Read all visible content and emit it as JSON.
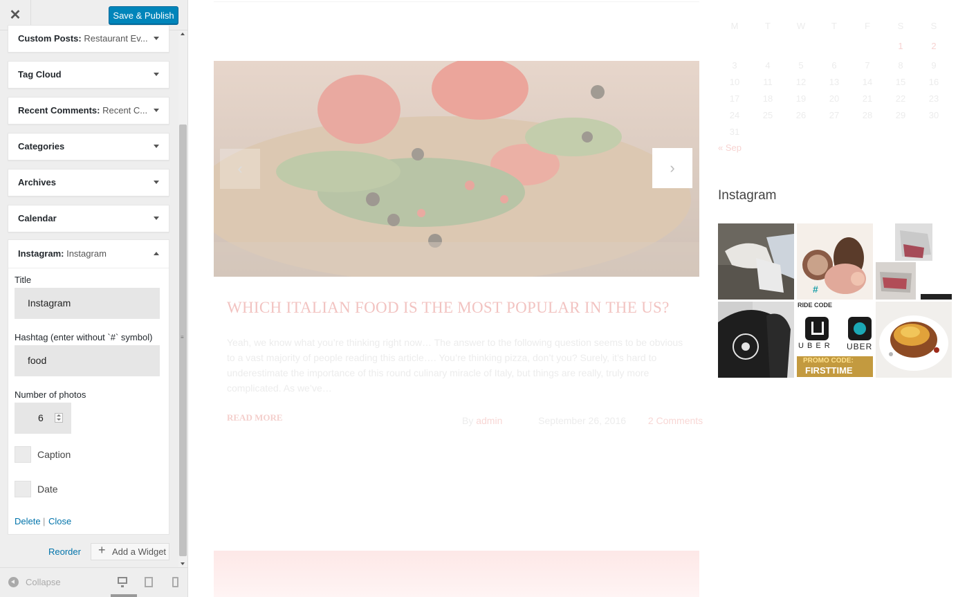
{
  "header": {
    "close_icon": "close-icon",
    "save_label": "Save & Publish"
  },
  "widgets": [
    {
      "title": "Custom Posts:",
      "sub": "Restaurant Ev..."
    },
    {
      "title": "Tag Cloud",
      "sub": ""
    },
    {
      "title": "Recent Comments:",
      "sub": "Recent C..."
    },
    {
      "title": "Categories",
      "sub": ""
    },
    {
      "title": "Archives",
      "sub": ""
    },
    {
      "title": "Calendar",
      "sub": ""
    }
  ],
  "instagram_widget": {
    "title": "Instagram:",
    "sub": "Instagram",
    "title_label": "Title",
    "title_value": "Instagram",
    "hashtag_label": "Hashtag (enter without `#` symbol)",
    "hashtag_value": "food",
    "photos_label": "Number of photos",
    "photos_value": "6",
    "caption_label": "Caption",
    "date_label": "Date",
    "delete_label": "Delete",
    "separator": "|",
    "close_label": "Close"
  },
  "actions": {
    "reorder_label": "Reorder",
    "add_widget_label": "Add a Widget"
  },
  "footer": {
    "collapse_label": "Collapse"
  },
  "post": {
    "title": "WHICH ITALIAN FOOD IS THE MOST POPULAR IN THE US?",
    "excerpt": "Yeah, we know what you’re thinking right now… The answer to the following question seems to be obvious to a vast majority of people reading this article…. You’re thinking pizza, don’t you? Surely, it’s hard to underestimate the importance of this round culinary miracle of Italy, but things are really, truly more complicated. As we’ve…",
    "read_more": "READ MORE",
    "by": "By",
    "author": "admin",
    "date": "September 26, 2016",
    "comments": "2 Comments"
  },
  "calendar": {
    "weekdays": [
      "M",
      "T",
      "W",
      "T",
      "F",
      "S",
      "S"
    ],
    "rows": [
      [
        "",
        "",
        "",
        "",
        "",
        "1",
        "2"
      ],
      [
        "3",
        "4",
        "5",
        "6",
        "7",
        "8",
        "9"
      ],
      [
        "10",
        "11",
        "12",
        "13",
        "14",
        "15",
        "16"
      ],
      [
        "17",
        "18",
        "19",
        "20",
        "21",
        "22",
        "23"
      ],
      [
        "24",
        "25",
        "26",
        "27",
        "28",
        "29",
        "30"
      ],
      [
        "31",
        "",
        "",
        "",
        "",
        "",
        ""
      ]
    ],
    "linked_days": [
      "1",
      "2"
    ],
    "prev_link": "« Sep"
  },
  "instagram_feed": {
    "title": "Instagram",
    "photos": [
      {
        "name": "instagram-photo-1",
        "caption": ""
      },
      {
        "name": "instagram-photo-2",
        "caption": ""
      },
      {
        "name": "instagram-photo-3",
        "caption": ""
      },
      {
        "name": "instagram-photo-4",
        "caption": ""
      },
      {
        "name": "instagram-photo-5",
        "caption": "RIDE CODE"
      },
      {
        "name": "instagram-photo-6",
        "caption": ""
      }
    ],
    "uber_text": "UBER",
    "uber_letters": "U B E R",
    "promo_line1": "PROMO CODE:",
    "promo_line2": "FIRSTTIME"
  },
  "colors": {
    "primary_button": "#0085ba",
    "link": "#0073aa",
    "accent_pink": "#f2c3c1"
  }
}
